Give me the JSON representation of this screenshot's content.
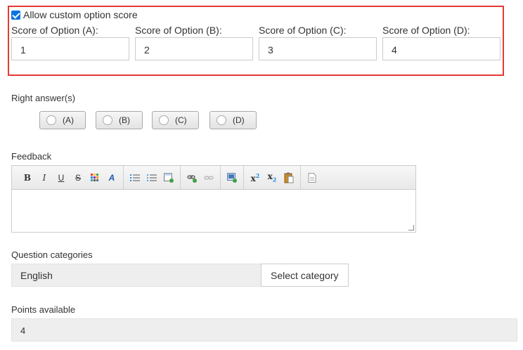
{
  "custom_score": {
    "checkbox_label": "Allow custom option score",
    "checked": true,
    "options": [
      {
        "label": "Score of Option (A):",
        "value": "1"
      },
      {
        "label": "Score of Option (B):",
        "value": "2"
      },
      {
        "label": "Score of Option (C):",
        "value": "3"
      },
      {
        "label": "Score of Option (D):",
        "value": "4"
      }
    ]
  },
  "right_answers": {
    "label": "Right answer(s)",
    "choices": [
      "(A)",
      "(B)",
      "(C)",
      "(D)"
    ]
  },
  "feedback": {
    "label": "Feedback",
    "text": ""
  },
  "categories": {
    "label": "Question categories",
    "value": "English",
    "button_label": "Select category"
  },
  "points": {
    "label": "Points available",
    "value": "4"
  }
}
